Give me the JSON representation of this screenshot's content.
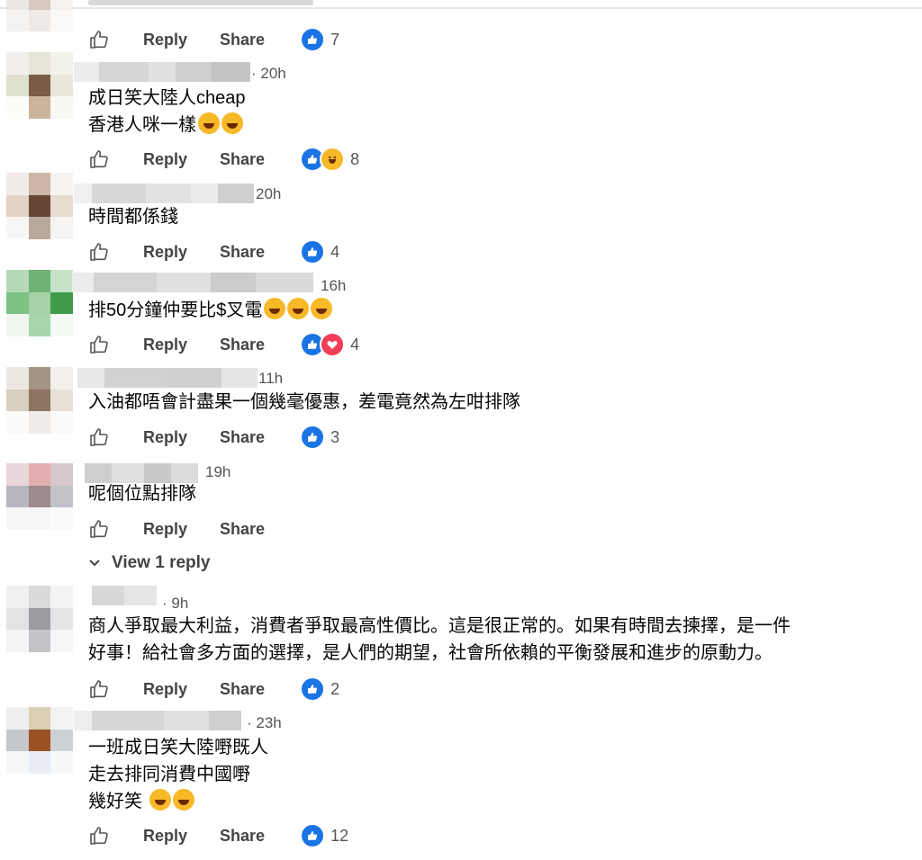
{
  "actions": {
    "reply_label": "Reply",
    "share_label": "Share"
  },
  "comments": [
    {
      "time": "",
      "lines": [],
      "reaction_count": "7"
    },
    {
      "time": "· 20h",
      "lines": [
        "成日笑大陸人cheap",
        "香港人咪一樣"
      ],
      "reaction_count": "8"
    },
    {
      "time": "20h",
      "lines": [
        "時間都係錢"
      ],
      "reaction_count": "4"
    },
    {
      "time": "16h",
      "lines": [
        "排50分鐘仲要比$叉電"
      ],
      "reaction_count": "4"
    },
    {
      "time": "11h",
      "lines": [
        "入油都唔會計盡果一個幾毫優惠，差電竟然為左咁排隊"
      ],
      "reaction_count": "3"
    },
    {
      "time": "19h",
      "lines": [
        "呢個位點排隊"
      ],
      "reaction_count": ""
    },
    {
      "time": "· 9h",
      "lines": [
        "商人爭取最大利益，消費者爭取最高性價比。這是很正常的。如果有時間去揀擇，是一件",
        "好事！給社會多方面的選擇，是人們的期望，社會所依賴的平衡發展和進步的原動力。"
      ],
      "reaction_count": "2"
    },
    {
      "time": "· 23h",
      "lines": [
        "一班成日笑大陸嘢既人",
        "走去排同消費中國嘢",
        "幾好笑 "
      ],
      "reaction_count": "12"
    }
  ],
  "view_reply_label": "View 1 reply",
  "colors": {
    "like": "#1b74e4",
    "haha": "#f7b928",
    "love": "#f33e58"
  }
}
